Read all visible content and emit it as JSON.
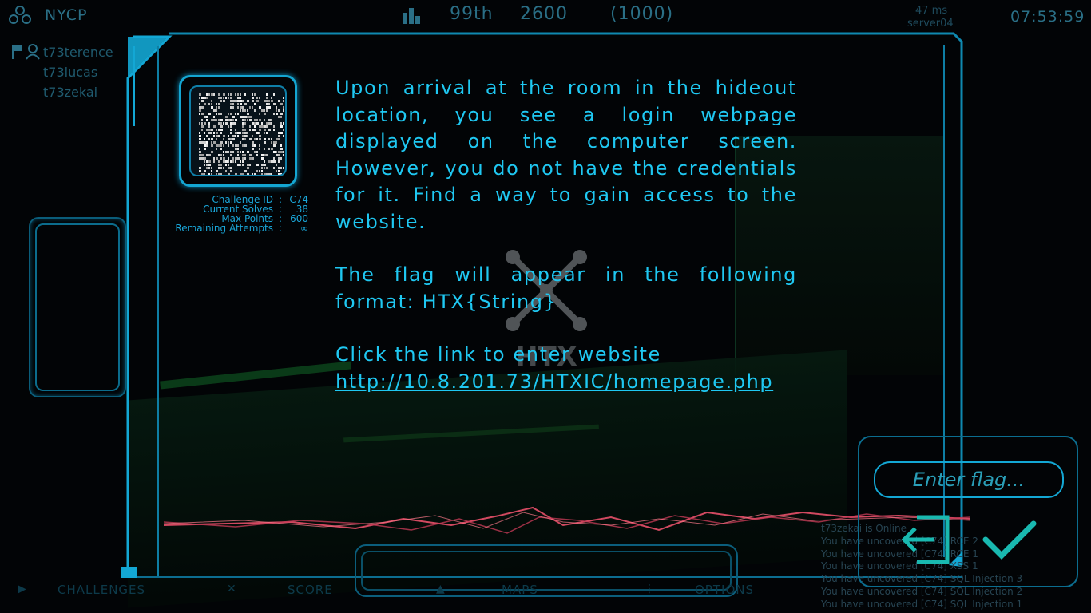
{
  "header": {
    "team_name": "NYCP",
    "rank": "99th",
    "score": "2600",
    "max_score": "(1000)",
    "ping": "47 ms",
    "server": "server04",
    "clock": "07:53:59"
  },
  "team": {
    "members": [
      "t73terence",
      "t73lucas",
      "t73zekai"
    ]
  },
  "challenge": {
    "meta": [
      {
        "label": "Challenge ID",
        "value": "C74"
      },
      {
        "label": "Current Solves",
        "value": "38"
      },
      {
        "label": "Max Points",
        "value": "600"
      },
      {
        "label": "Remaining Attempts",
        "value": "∞"
      }
    ],
    "paragraph1": "Upon arrival at the room in the hideout location, you see a login webpage displayed on the computer screen. However, you do not have the credentials for it. Find a way to gain access to the website.",
    "paragraph2": "The flag will appear in the following format: HTX{String}",
    "paragraph3": "Click the link to enter website",
    "link": "http://10.8.201.73/HTXIC/homepage.php",
    "watermark_text": "HTX"
  },
  "flag": {
    "placeholder": "Enter flag..."
  },
  "nav": {
    "items": [
      "CHALLENGES",
      "SCORE",
      "MAPS",
      "OPTIONS"
    ]
  },
  "log": [
    "t73zekai is Online",
    "You have uncovered [C74] RCE 2",
    "You have uncovered [C74] RCE 1",
    "You have uncovered [C74] XSS 1",
    "You have uncovered [C74] SQL Injection 3",
    "You have uncovered [C74] SQL Injection 2",
    "You have uncovered [C74] SQL Injection 1"
  ],
  "colors": {
    "accent": "#1fc8f2",
    "frame": "#13a7d4",
    "dim": "#2a6f86",
    "wave": "#e8506a",
    "check": "#19b9b0"
  },
  "icons": {
    "team": "team-icon",
    "rank": "bar-chart-icon",
    "flag": "flag-icon",
    "user": "user-icon",
    "exit": "exit-icon",
    "submit": "checkmark-icon"
  }
}
